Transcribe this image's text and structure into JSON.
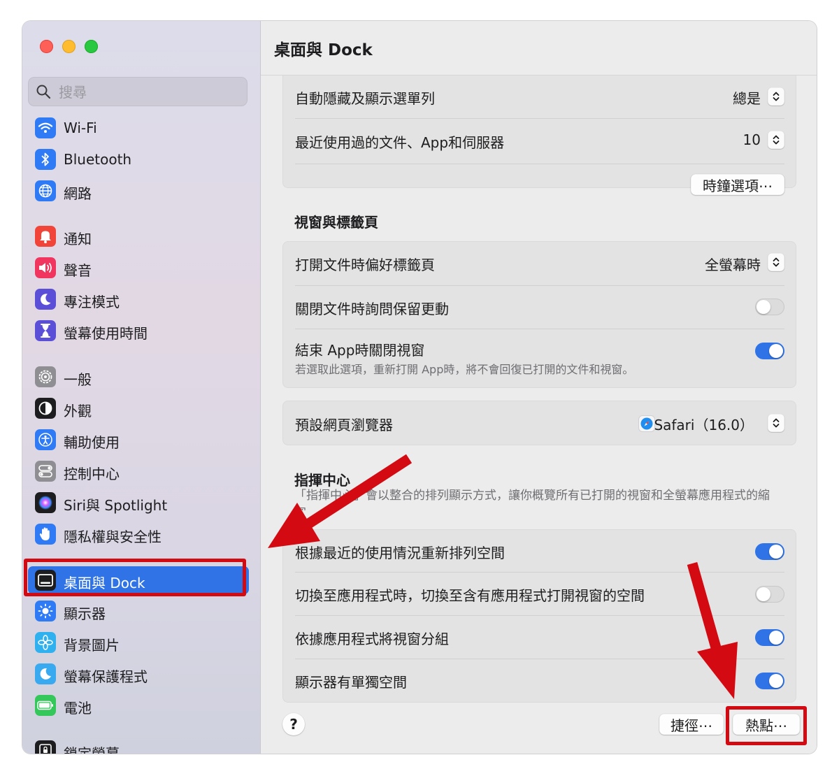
{
  "sidebar": {
    "search": {
      "placeholder": "搜尋",
      "value": ""
    },
    "items": [
      {
        "label": "Wi-Fi",
        "icon": "wifi-icon",
        "color": "#2f7bf6"
      },
      {
        "label": "Bluetooth",
        "icon": "bluetooth-icon",
        "color": "#2f7bf6"
      },
      {
        "label": "網路",
        "icon": "globe-icon",
        "color": "#2f7bf6"
      },
      {
        "label": "通知",
        "icon": "bell-icon",
        "color": "#f2453a"
      },
      {
        "label": "聲音",
        "icon": "speaker-icon",
        "color": "#f0355f"
      },
      {
        "label": "專注模式",
        "icon": "moon-icon",
        "color": "#5b4fd8"
      },
      {
        "label": "螢幕使用時間",
        "icon": "hourglass-icon",
        "color": "#5b4fd8"
      },
      {
        "label": "一般",
        "icon": "gear-icon",
        "color": "#8e8e93"
      },
      {
        "label": "外觀",
        "icon": "appearance-icon",
        "color": "#1d1d1f"
      },
      {
        "label": "輔助使用",
        "icon": "accessibility-icon",
        "color": "#2f7bf6"
      },
      {
        "label": "控制中心",
        "icon": "switches-icon",
        "color": "#8e8e93"
      },
      {
        "label": "Siri與 Spotlight",
        "icon": "siri-icon",
        "color": "#1d1d1f"
      },
      {
        "label": "隱私權與安全性",
        "icon": "hand-icon",
        "color": "#2f7bf6"
      },
      {
        "label": "桌面與 Dock",
        "icon": "dock-icon",
        "color": "#1d1d1f",
        "selected": true
      },
      {
        "label": "顯示器",
        "icon": "sun-icon",
        "color": "#2f7bf6"
      },
      {
        "label": "背景圖片",
        "icon": "flower-icon",
        "color": "#2fb1f0"
      },
      {
        "label": "螢幕保護程式",
        "icon": "screensaver-icon",
        "color": "#3aaaf0"
      },
      {
        "label": "電池",
        "icon": "battery-icon",
        "color": "#34c759"
      },
      {
        "label": "鎖定螢幕",
        "icon": "lock-icon",
        "color": "#1d1d1f"
      }
    ]
  },
  "main": {
    "title": "桌面與 Dock",
    "card1": {
      "partial_label": "自動隱藏及顯示選單列",
      "partial_value": "總是",
      "recent_label": "最近使用過的文件、App和伺服器",
      "recent_value": "10",
      "clock_button": "時鐘選項⋯"
    },
    "windows_section": {
      "title": "視窗與標籤頁",
      "prefer_tabs_label": "打開文件時偏好標籤頁",
      "prefer_tabs_value": "全螢幕時",
      "ask_keep_label": "關閉文件時詢問保留更動",
      "ask_keep_on": false,
      "close_windows_label": "結束 App時關閉視窗",
      "close_windows_desc": "若選取此選項，重新打開 App時，將不會回復已打開的文件和視窗。",
      "close_windows_on": true
    },
    "browser": {
      "label": "預設網頁瀏覽器",
      "value": "Safari（16.0）",
      "icon": "safari-icon"
    },
    "mission_control": {
      "title": "指揮中心",
      "desc": "「指揮中心」會以整合的排列顯示方式，讓你概覽所有已打開的視窗和全螢幕應用程式的縮圖。",
      "rows": [
        {
          "label": "根據最近的使用情況重新排列空間",
          "on": true
        },
        {
          "label": "切換至應用程式時，切換至含有應用程式打開視窗的空間",
          "on": false
        },
        {
          "label": "依據應用程式將視窗分組",
          "on": true
        },
        {
          "label": "顯示器有單獨空間",
          "on": true
        }
      ]
    },
    "footer": {
      "help": "?",
      "shortcuts_button": "捷徑⋯",
      "hot_corners_button": "熱點⋯"
    }
  },
  "colors": {
    "accent": "#2f73e6",
    "annotation_red": "#d40a12"
  }
}
